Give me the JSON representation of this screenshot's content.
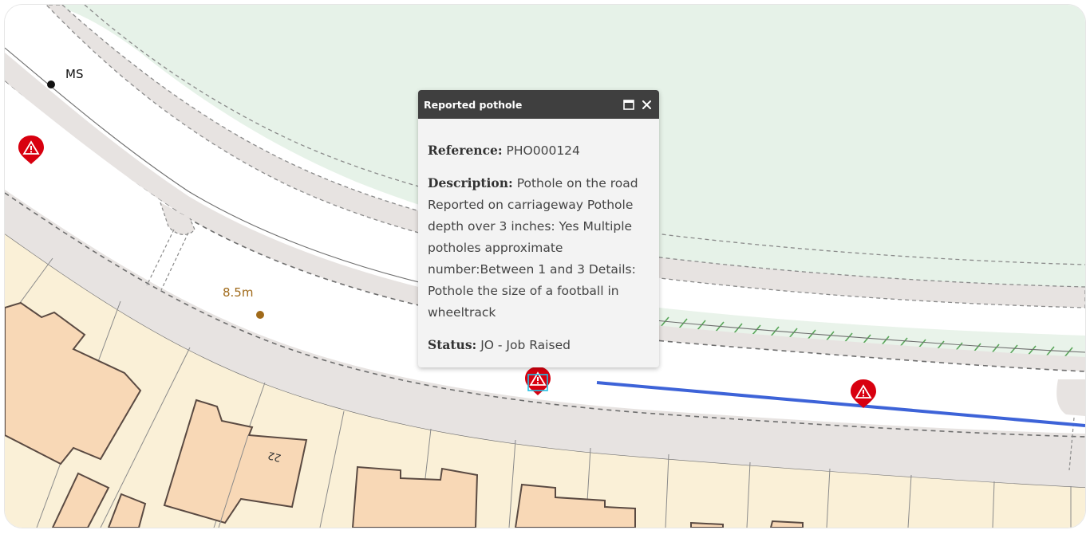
{
  "map": {
    "labels": {
      "ms": "MS",
      "distance": "8.5m",
      "house_number": "22"
    },
    "colors": {
      "grass": "#e6f2e8",
      "pavement": "#e7e3e1",
      "road": "#ffffff",
      "plot": "#faf0d7",
      "building": "#f8d8b6",
      "building_outline": "#5a4a42",
      "route_line": "#3d63d8",
      "marker": "#d8000f",
      "distance_label": "#a06a1a",
      "hatch": "#5aa65a",
      "selection": "#22c0e6"
    },
    "markers": [
      {
        "icon": "pothole-warning-icon"
      },
      {
        "icon": "pothole-warning-icon"
      },
      {
        "icon": "pothole-warning-icon"
      }
    ]
  },
  "popup": {
    "title": "Reported pothole",
    "maximize_icon": "maximize-icon",
    "close_icon": "close-icon",
    "reference_label": "Reference:",
    "reference_value": "PHO000124",
    "description_label": "Description:",
    "description_value": "Pothole on the road Reported on carriageway Pothole depth over 3 inches: Yes Multiple potholes approximate number:Between 1 and 3 Details: Pothole the size of a football in wheeltrack",
    "status_label": "Status:",
    "status_value": "JO - Job Raised"
  }
}
